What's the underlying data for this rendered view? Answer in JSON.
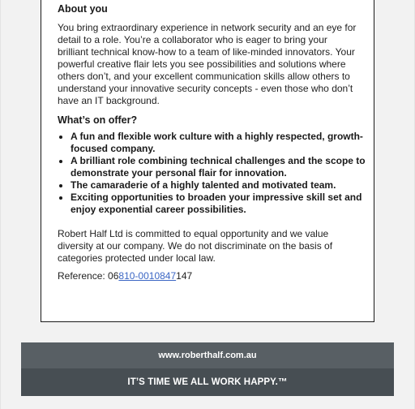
{
  "about": {
    "heading": "About you",
    "text": "You bring extraordinary experience in network security and an eye for detail to a role. You’re a collaborator who is eager to bring your brilliant technical know-how to a team of like-minded innovators. Your powerful creative flair lets you see possibilities and solutions where others don’t, and your excellent communication skills allow others to understand your innovative security concepts - even those who don’t have an IT background."
  },
  "offer": {
    "heading": "What’s on offer?",
    "items": [
      "A fun and flexible work culture with a highly respected, growth-focused company.",
      "A brilliant role combining technical challenges and the scope to demonstrate your personal flair for innovation.",
      "The camaraderie of a highly talented and motivated team.",
      "Exciting opportunities to broaden your impressive skill set and enjoy exponential career possibilities."
    ]
  },
  "equal_opportunity": "Robert Half Ltd is committed to equal opportunity and we value diversity at our company. We do not discriminate on the basis of categories protected under local law.",
  "reference": {
    "label": "Reference: ",
    "prefix": "06",
    "link_text": "810-0010847",
    "suffix": "147"
  },
  "footer": {
    "url": "www.roberthalf.com.au",
    "tagline": "IT’S TIME WE ALL WORK HAPPY.™"
  }
}
